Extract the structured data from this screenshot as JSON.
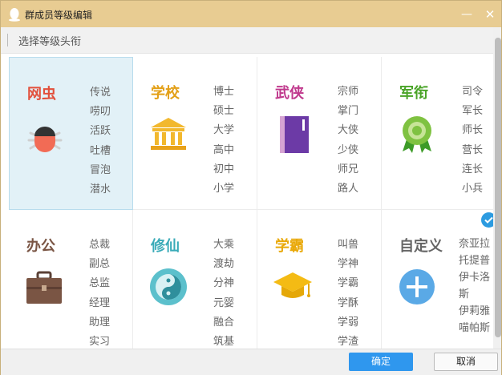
{
  "window": {
    "title": "群成员等级编辑",
    "min_label": "—",
    "close_label": "✕"
  },
  "subheader": {
    "text": "选择等级头衔"
  },
  "categories": [
    {
      "title": "网虫",
      "color": "#e2503c",
      "icon": "bug-icon",
      "selected": true,
      "levels": [
        "传说",
        "唠叨",
        "活跃",
        "吐槽",
        "冒泡",
        "潜水"
      ]
    },
    {
      "title": "学校",
      "color": "#e3a018",
      "icon": "school-building-icon",
      "selected": false,
      "levels": [
        "博士",
        "硕士",
        "大学",
        "高中",
        "初中",
        "小学"
      ]
    },
    {
      "title": "武侠",
      "color": "#c0398d",
      "icon": "book-icon",
      "selected": false,
      "levels": [
        "宗师",
        "掌门",
        "大侠",
        "少侠",
        "师兄",
        "路人"
      ]
    },
    {
      "title": "军衔",
      "color": "#4aa428",
      "icon": "medal-icon",
      "selected": false,
      "levels": [
        "司令",
        "军长",
        "师长",
        "营长",
        "连长",
        "小兵"
      ]
    },
    {
      "title": "办公",
      "color": "#7a5544",
      "icon": "briefcase-icon",
      "selected": false,
      "levels": [
        "总裁",
        "副总",
        "总监",
        "经理",
        "助理",
        "实习"
      ]
    },
    {
      "title": "修仙",
      "color": "#3aabb8",
      "icon": "yin-yang-icon",
      "selected": false,
      "levels": [
        "大乘",
        "渡劫",
        "分神",
        "元婴",
        "融合",
        "筑基"
      ]
    },
    {
      "title": "学霸",
      "color": "#e9a90a",
      "icon": "graduation-cap-icon",
      "selected": false,
      "levels": [
        "叫兽",
        "学神",
        "学霸",
        "学酥",
        "学弱",
        "学渣"
      ]
    },
    {
      "title": "自定义",
      "color": "#666666",
      "icon": "plus-icon",
      "selected": false,
      "levels": [
        "奈亚拉托提普",
        "伊卡洛斯",
        "伊莉雅",
        "喵帕斯"
      ]
    }
  ],
  "buttons": {
    "ok": "确定",
    "cancel": "取消"
  }
}
